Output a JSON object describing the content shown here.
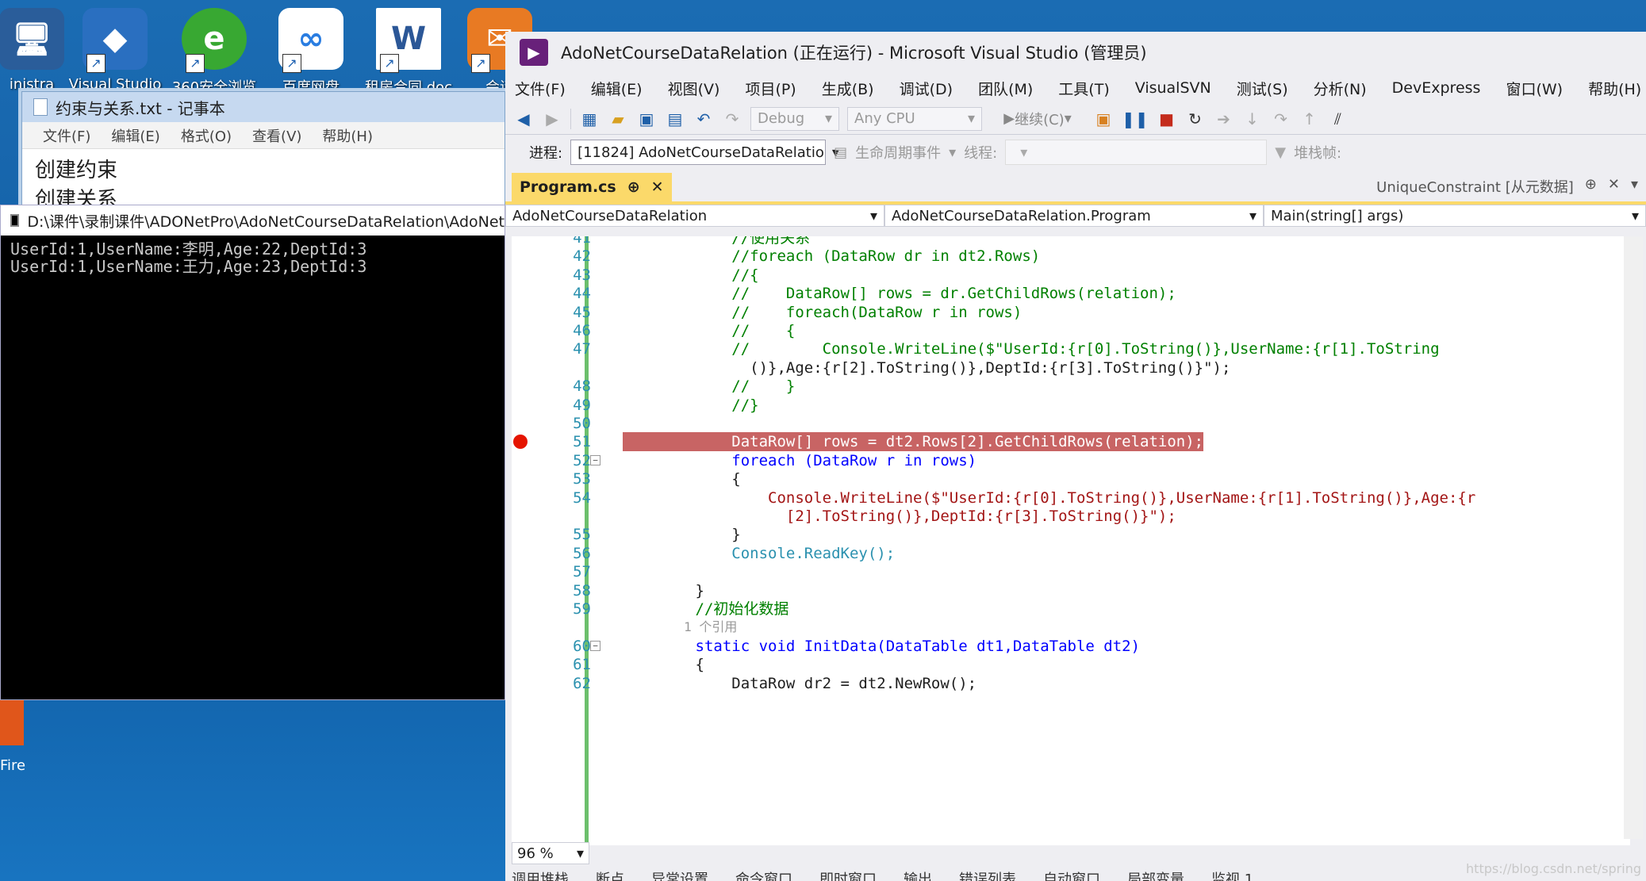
{
  "desktop": {
    "icons": [
      {
        "label": "inistra",
        "name": "admin-icon",
        "glyph": "🖥"
      },
      {
        "label": "Visual Studio",
        "name": "visual-studio-shortcut-icon",
        "glyph": "◆"
      },
      {
        "label": "360安全浏览",
        "name": "browser-360-shortcut-icon",
        "glyph": "e"
      },
      {
        "label": "百度网盘",
        "name": "baidu-netdisk-shortcut-icon",
        "glyph": "∞"
      },
      {
        "label": "租房合同.doc",
        "name": "word-doc-shortcut-icon",
        "glyph": "W"
      },
      {
        "label": "会话",
        "name": "chat-shortcut-icon",
        "glyph": "✉"
      }
    ],
    "side_labels": [
      "Fire"
    ]
  },
  "notepad": {
    "title": "约束与关系.txt - 记事本",
    "menu": [
      "文件(F)",
      "编辑(E)",
      "格式(O)",
      "查看(V)",
      "帮助(H)"
    ],
    "lines": [
      "创建约束",
      "创建关系"
    ]
  },
  "console": {
    "title": "D:\\课件\\录制课件\\ADONetPro\\AdoNetCourseDataRelation\\AdoNet",
    "output": [
      "UserId:1,UserName:李明,Age:22,DeptId:3",
      "UserId:1,UserName:王力,Age:23,DeptId:3"
    ]
  },
  "vs": {
    "title": "AdoNetCourseDataRelation (正在运行) - Microsoft Visual Studio (管理员)",
    "menu": [
      "文件(F)",
      "编辑(E)",
      "视图(V)",
      "项目(P)",
      "生成(B)",
      "调试(D)",
      "团队(M)",
      "工具(T)",
      "VisualSVN",
      "测试(S)",
      "分析(N)",
      "DevExpress",
      "窗口(W)",
      "帮助(H)"
    ],
    "toolbar": {
      "config": "Debug",
      "platform": "Any CPU",
      "continue_label": "继续(C)"
    },
    "process_bar": {
      "process_label": "进程:",
      "process_value": "[11824] AdoNetCourseDataRelatio",
      "lifecycle_label": "生命周期事件",
      "thread_label": "线程:",
      "stackframe_label": "堆栈帧:"
    },
    "tabs": {
      "active": "Program.cs",
      "right": "UniqueConstraint [从元数据]"
    },
    "nav": {
      "project": "AdoNetCourseDataRelation",
      "class": "AdoNetCourseDataRelation.Program",
      "member": "Main(string[] args)"
    },
    "code_lines": [
      {
        "n": "41",
        "text": "            //使用关系"
      },
      {
        "n": "42",
        "text": "            //foreach (DataRow dr in dt2.Rows)"
      },
      {
        "n": "43",
        "text": "            //{"
      },
      {
        "n": "44",
        "text": "            //    DataRow[] rows = dr.GetChildRows(relation);"
      },
      {
        "n": "45",
        "text": "            //    foreach(DataRow r in rows)"
      },
      {
        "n": "46",
        "text": "            //    {"
      },
      {
        "n": "47",
        "text": "            //        Console.WriteLine($\"UserId:{r[0].ToString()},UserName:{r[1].ToString"
      },
      {
        "n": "",
        "text": "              ()},Age:{r[2].ToString()},DeptId:{r[3].ToString()}\");"
      },
      {
        "n": "48",
        "text": "            //    }"
      },
      {
        "n": "49",
        "text": "            //}"
      },
      {
        "n": "50",
        "text": ""
      },
      {
        "n": "51",
        "text": "            DataRow[] rows = dt2.Rows[2].GetChildRows(relation);"
      },
      {
        "n": "52",
        "text": "            foreach (DataRow r in rows)"
      },
      {
        "n": "53",
        "text": "            {"
      },
      {
        "n": "54",
        "text": "                Console.WriteLine($\"UserId:{r[0].ToString()},UserName:{r[1].ToString()},Age:{r"
      },
      {
        "n": "",
        "text": "                  [2].ToString()},DeptId:{r[3].ToString()}\");"
      },
      {
        "n": "55",
        "text": "            }"
      },
      {
        "n": "56",
        "text": "            Console.ReadKey();"
      },
      {
        "n": "57",
        "text": ""
      },
      {
        "n": "58",
        "text": "        }"
      },
      {
        "n": "59",
        "text": "        //初始化数据"
      },
      {
        "n": "",
        "text": "        1 个引用"
      },
      {
        "n": "60",
        "text": "        static void InitData(DataTable dt1,DataTable dt2)"
      },
      {
        "n": "61",
        "text": "        {"
      },
      {
        "n": "62",
        "text": "            DataRow dr2 = dt2.NewRow();"
      }
    ],
    "zoom": "96 %",
    "bottom_tabs": [
      "调用堆栈",
      "断点",
      "异常设置",
      "命令窗口",
      "即时窗口",
      "输出",
      "错误列表",
      "自动窗口",
      "局部变量",
      "监视 1"
    ]
  },
  "watermark": "https://blog.csdn.net/spring"
}
